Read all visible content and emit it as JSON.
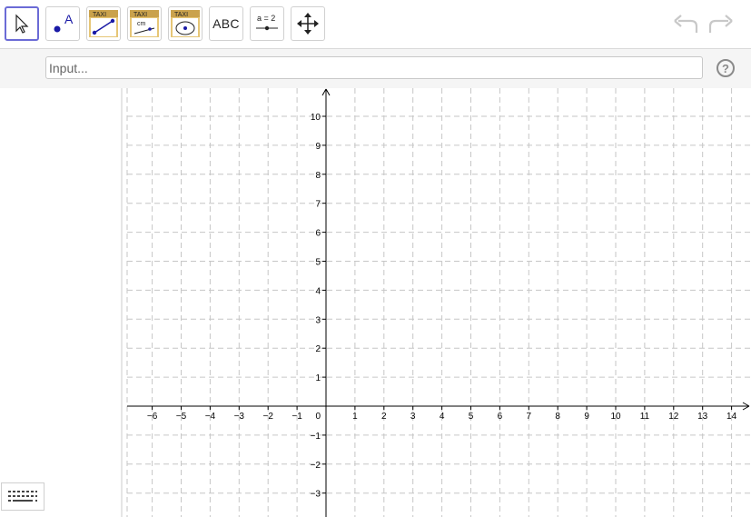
{
  "toolbar": {
    "tools": [
      {
        "name": "move-tool",
        "label": "Move"
      },
      {
        "name": "point-tool",
        "label": "A"
      },
      {
        "name": "taxi-segment-tool",
        "label": "TAXI"
      },
      {
        "name": "taxi-distance-tool",
        "label": "TAXI",
        "sub": "cm"
      },
      {
        "name": "taxi-circle-tool",
        "label": "TAXI"
      },
      {
        "name": "text-tool",
        "label": "ABC"
      },
      {
        "name": "slider-tool",
        "label": "a = 2"
      },
      {
        "name": "move-graphics-view-tool",
        "label": "Move Graphics View"
      }
    ]
  },
  "input": {
    "placeholder": "Input..."
  },
  "help": {
    "label": "?"
  },
  "graphics": {
    "x_ticks": [
      -6,
      -5,
      -4,
      -3,
      -2,
      -1,
      1,
      2,
      3,
      4,
      5,
      6,
      7,
      8,
      9,
      10,
      11,
      12,
      13,
      14
    ],
    "y_ticks": [
      10,
      9,
      8,
      7,
      6,
      5,
      4,
      3,
      2,
      1,
      -1,
      -2,
      -3
    ],
    "origin_label": "0",
    "grid": true
  },
  "colors": {
    "accent": "#6b6bd6",
    "point": "#1a1aa6",
    "grid": "#c6c6c6"
  }
}
